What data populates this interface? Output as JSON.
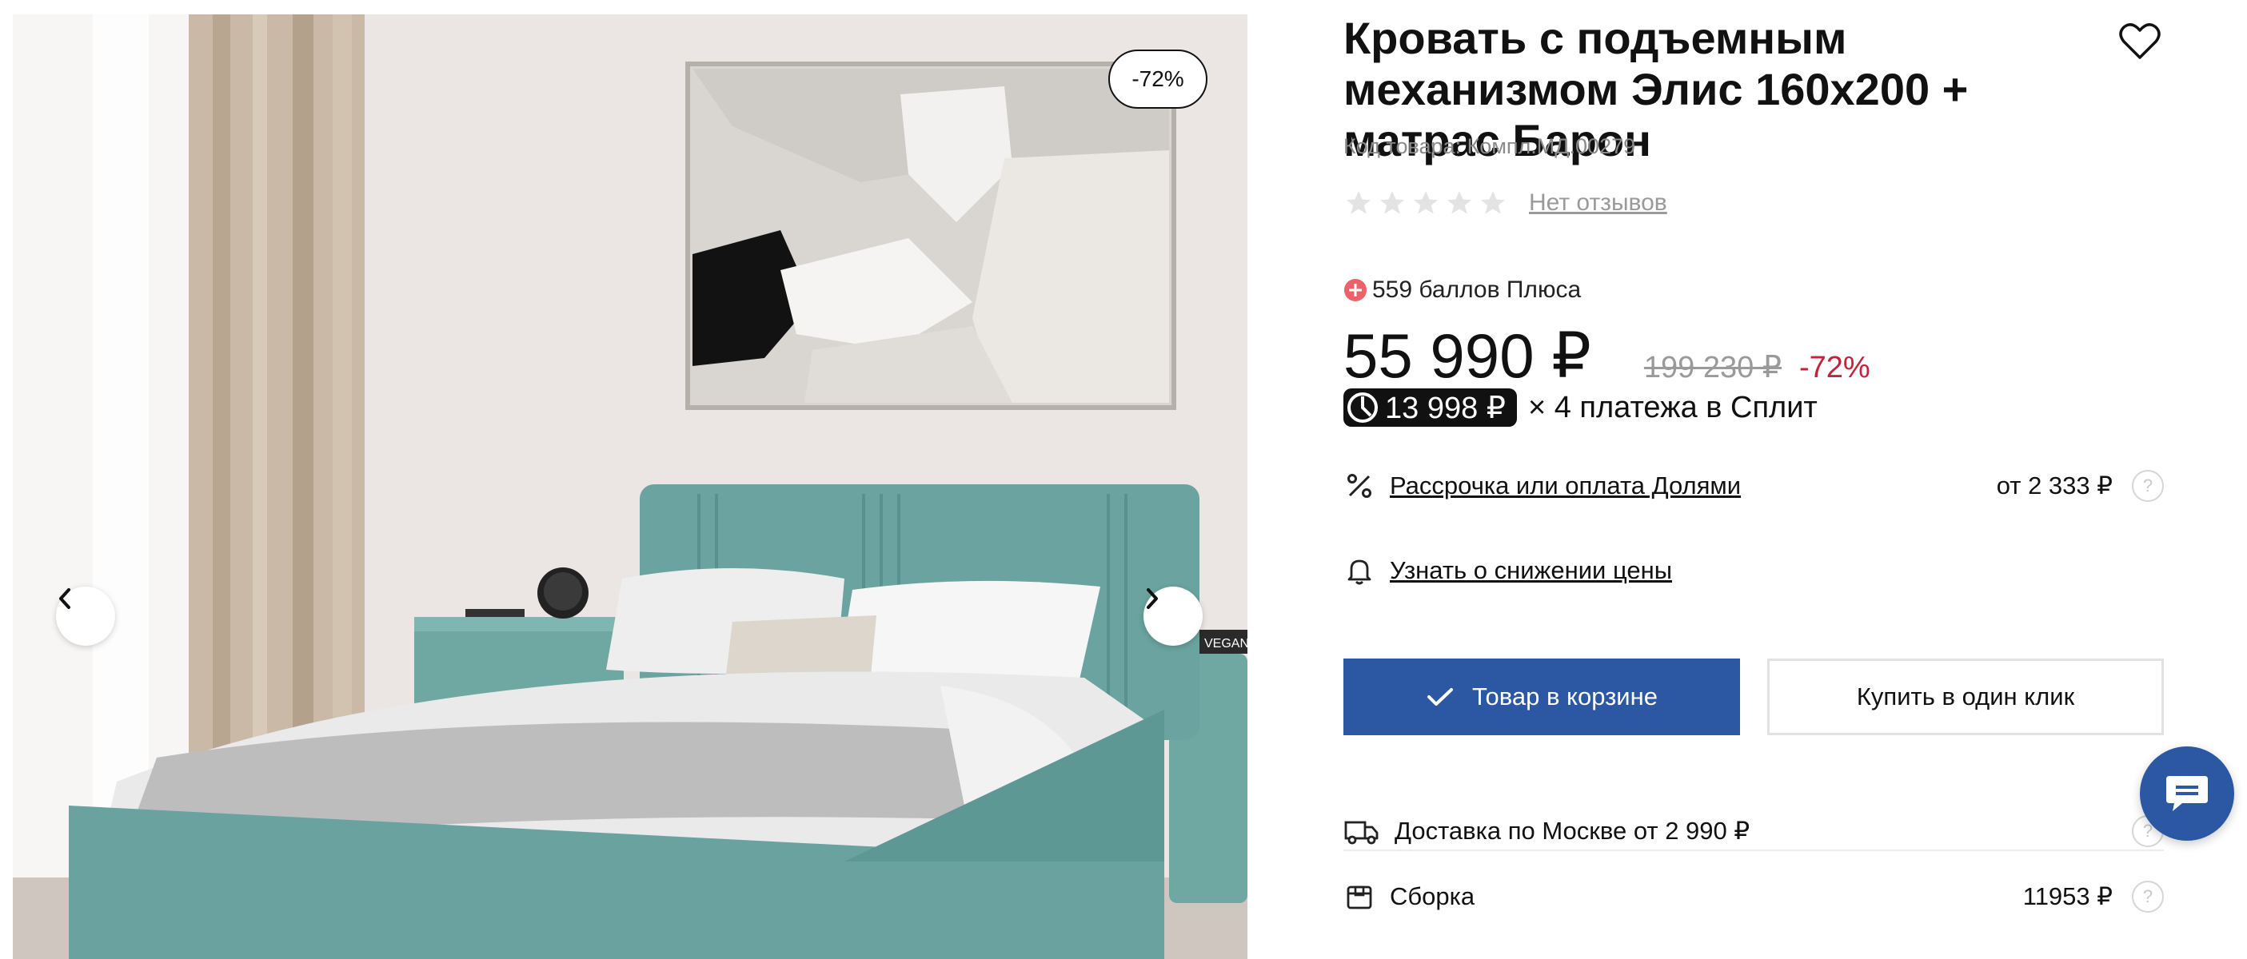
{
  "product": {
    "title": "Кровать с подъемным механизмом Элис 160х200 + матрас Барон",
    "code": "Код товара: Компл.МД.00279",
    "reviews_link": "Нет отзывов",
    "rating_stars": 0,
    "rating_max": 5
  },
  "gallery": {
    "badge": "-72%",
    "book_text": "VEGAN",
    "prev_icon": "chevron-left-icon",
    "next_icon": "chevron-right-icon"
  },
  "loyalty": {
    "text": "559 баллов Плюса"
  },
  "price": {
    "current": "55 990 ₽",
    "old": "199 230 ₽",
    "discount": "-72%",
    "discount_color": "#c4213c"
  },
  "split": {
    "amount": "13 998 ₽",
    "text": "× 4 платежа в Сплит"
  },
  "installment": {
    "label": "Рассрочка или оплата Долями",
    "value": "от 2 333 ₽"
  },
  "price_alert": {
    "label": "Узнать о снижении цены"
  },
  "buttons": {
    "in_cart": "Товар в корзине",
    "one_click": "Купить в один клик",
    "accent": "#2b57a3"
  },
  "delivery": {
    "label": "Доставка по Москве от 2 990 ₽"
  },
  "assembly": {
    "label": "Сборка",
    "value": "11953 ₽"
  },
  "help_mark": "?"
}
